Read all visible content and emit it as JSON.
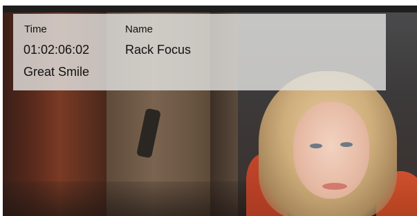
{
  "clip_overlay": {
    "time_label": "Time",
    "time_value": "01:02:06:02",
    "name_label": "Name",
    "name_value": "Rack Focus",
    "note": "Great Smile"
  },
  "colors": {
    "overlay_background": "#e1e1de",
    "text": "#111111"
  }
}
